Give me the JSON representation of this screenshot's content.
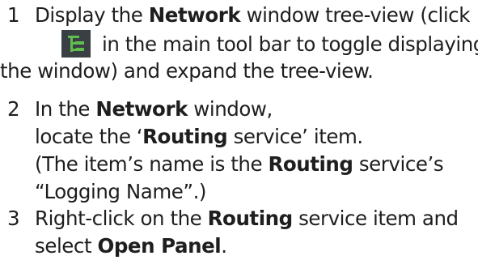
{
  "steps": [
    {
      "number": "1",
      "l1_pre": "Display the ",
      "l1_bold": "Network",
      "l1_post": " window tree-view (click",
      "l2_post": "in the main tool bar to toggle displaying",
      "l3": "the window) and expand the tree-view.",
      "icon": "network-tree-icon"
    },
    {
      "number": "2",
      "l1_pre": "In the ",
      "l1_bold": "Network",
      "l1_post": " window,",
      "l2_pre": "locate the ‘",
      "l2_bold": "Routing",
      "l2_post": " service’ item.",
      "l3_pre": "(The item’s name is the ",
      "l3_bold": "Routing",
      "l3_post": " service’s",
      "l4": "“Logging Name”.)"
    },
    {
      "number": "3",
      "l1_pre": "Right-click on the ",
      "l1_bold": "Routing",
      "l1_post": " service item and",
      "l2_pre": "select ",
      "l2_bold": "Open Panel",
      "l2_post": "."
    }
  ],
  "colors": {
    "text": "#1e1e1e",
    "icon_background": "#3a3f44",
    "icon_foreground": "#5fbe4e"
  }
}
